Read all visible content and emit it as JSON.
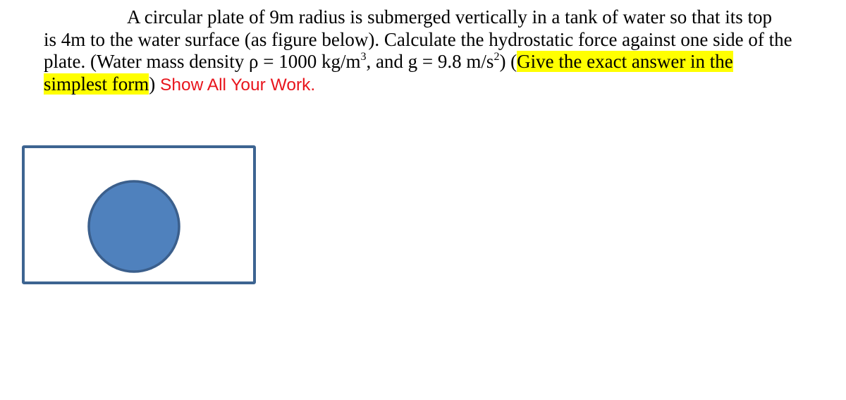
{
  "problem": {
    "line1": "A circular plate of 9m radius is submerged vertically in a tank of water so that its top",
    "line2": "is 4m to the water surface (as figure below).  Calculate the hydrostatic force against one side of the",
    "line3_a": "plate.  (Water mass density ρ = 1000 kg/m",
    "line3_sup1": "3",
    "line3_b": ", and g = 9.8 m/s",
    "line3_sup2": "2",
    "line3_c": ") (",
    "line3_highlight": "Give the exact answer in the",
    "line4_highlight": "simplest form",
    "line4_b": ") ",
    "instruction": "Show All Your Work."
  },
  "colors": {
    "highlight": "#ffff00",
    "instruction_red": "#e8151d",
    "tank_border": "#3d6491",
    "plate_fill": "#4f81bd",
    "plate_border": "#3b5f8c"
  },
  "figure": {
    "tank_label": "tank",
    "plate_label": "circular plate"
  }
}
